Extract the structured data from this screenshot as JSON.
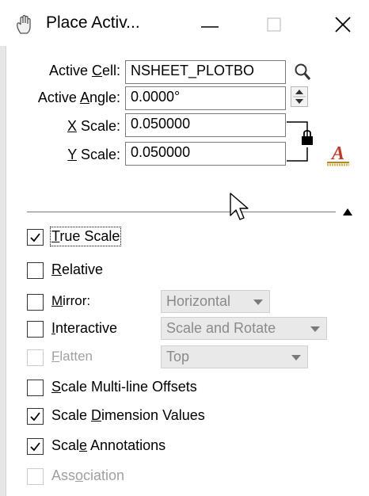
{
  "window": {
    "title": "Place Activ...",
    "icon": "hand-icon"
  },
  "fields": {
    "active_cell": {
      "label_pre": "Active ",
      "label_ul": "C",
      "label_post": "ell:",
      "value": "NSHEET_PLOTBO"
    },
    "active_angle": {
      "label_pre": "Active ",
      "label_ul": "A",
      "label_post": "ngle:",
      "value": "0.0000°"
    },
    "x_scale": {
      "label_pre": "",
      "label_ul": "X",
      "label_post": " Scale:",
      "value": "0.050000"
    },
    "y_scale": {
      "label_pre": "",
      "label_ul": "Y",
      "label_post": " Scale:",
      "value": "0.050000"
    }
  },
  "options": [
    {
      "pre": "",
      "ul": "T",
      "post": "rue Scale",
      "checked": true,
      "enabled": true
    },
    {
      "pre": "",
      "ul": "R",
      "post": "elative",
      "checked": false,
      "enabled": true
    },
    {
      "pre": "",
      "ul": "M",
      "post": "irror:",
      "checked": false,
      "enabled": true
    },
    {
      "pre": "",
      "ul": "I",
      "post": "nteractive",
      "checked": false,
      "enabled": true
    },
    {
      "pre": "",
      "ul": "F",
      "post": "latten",
      "checked": false,
      "enabled": false
    },
    {
      "pre": "",
      "ul": "S",
      "post": "cale Multi-line Offsets",
      "checked": false,
      "enabled": true
    },
    {
      "pre": "Scale ",
      "ul": "D",
      "post": "imension Values",
      "checked": true,
      "enabled": true
    },
    {
      "pre": "Scal",
      "ul": "e",
      "post": " Annotations",
      "checked": true,
      "enabled": true
    },
    {
      "pre": "Ass",
      "ul": "o",
      "post": "ciation",
      "checked": false,
      "enabled": false
    }
  ],
  "dropdowns": {
    "mirror": "Horizontal",
    "interactive": "Scale and Rotate",
    "flatten": "Top"
  },
  "colors": {
    "accent_red": "#c0392b",
    "disabled_text": "#a0a0a0"
  }
}
